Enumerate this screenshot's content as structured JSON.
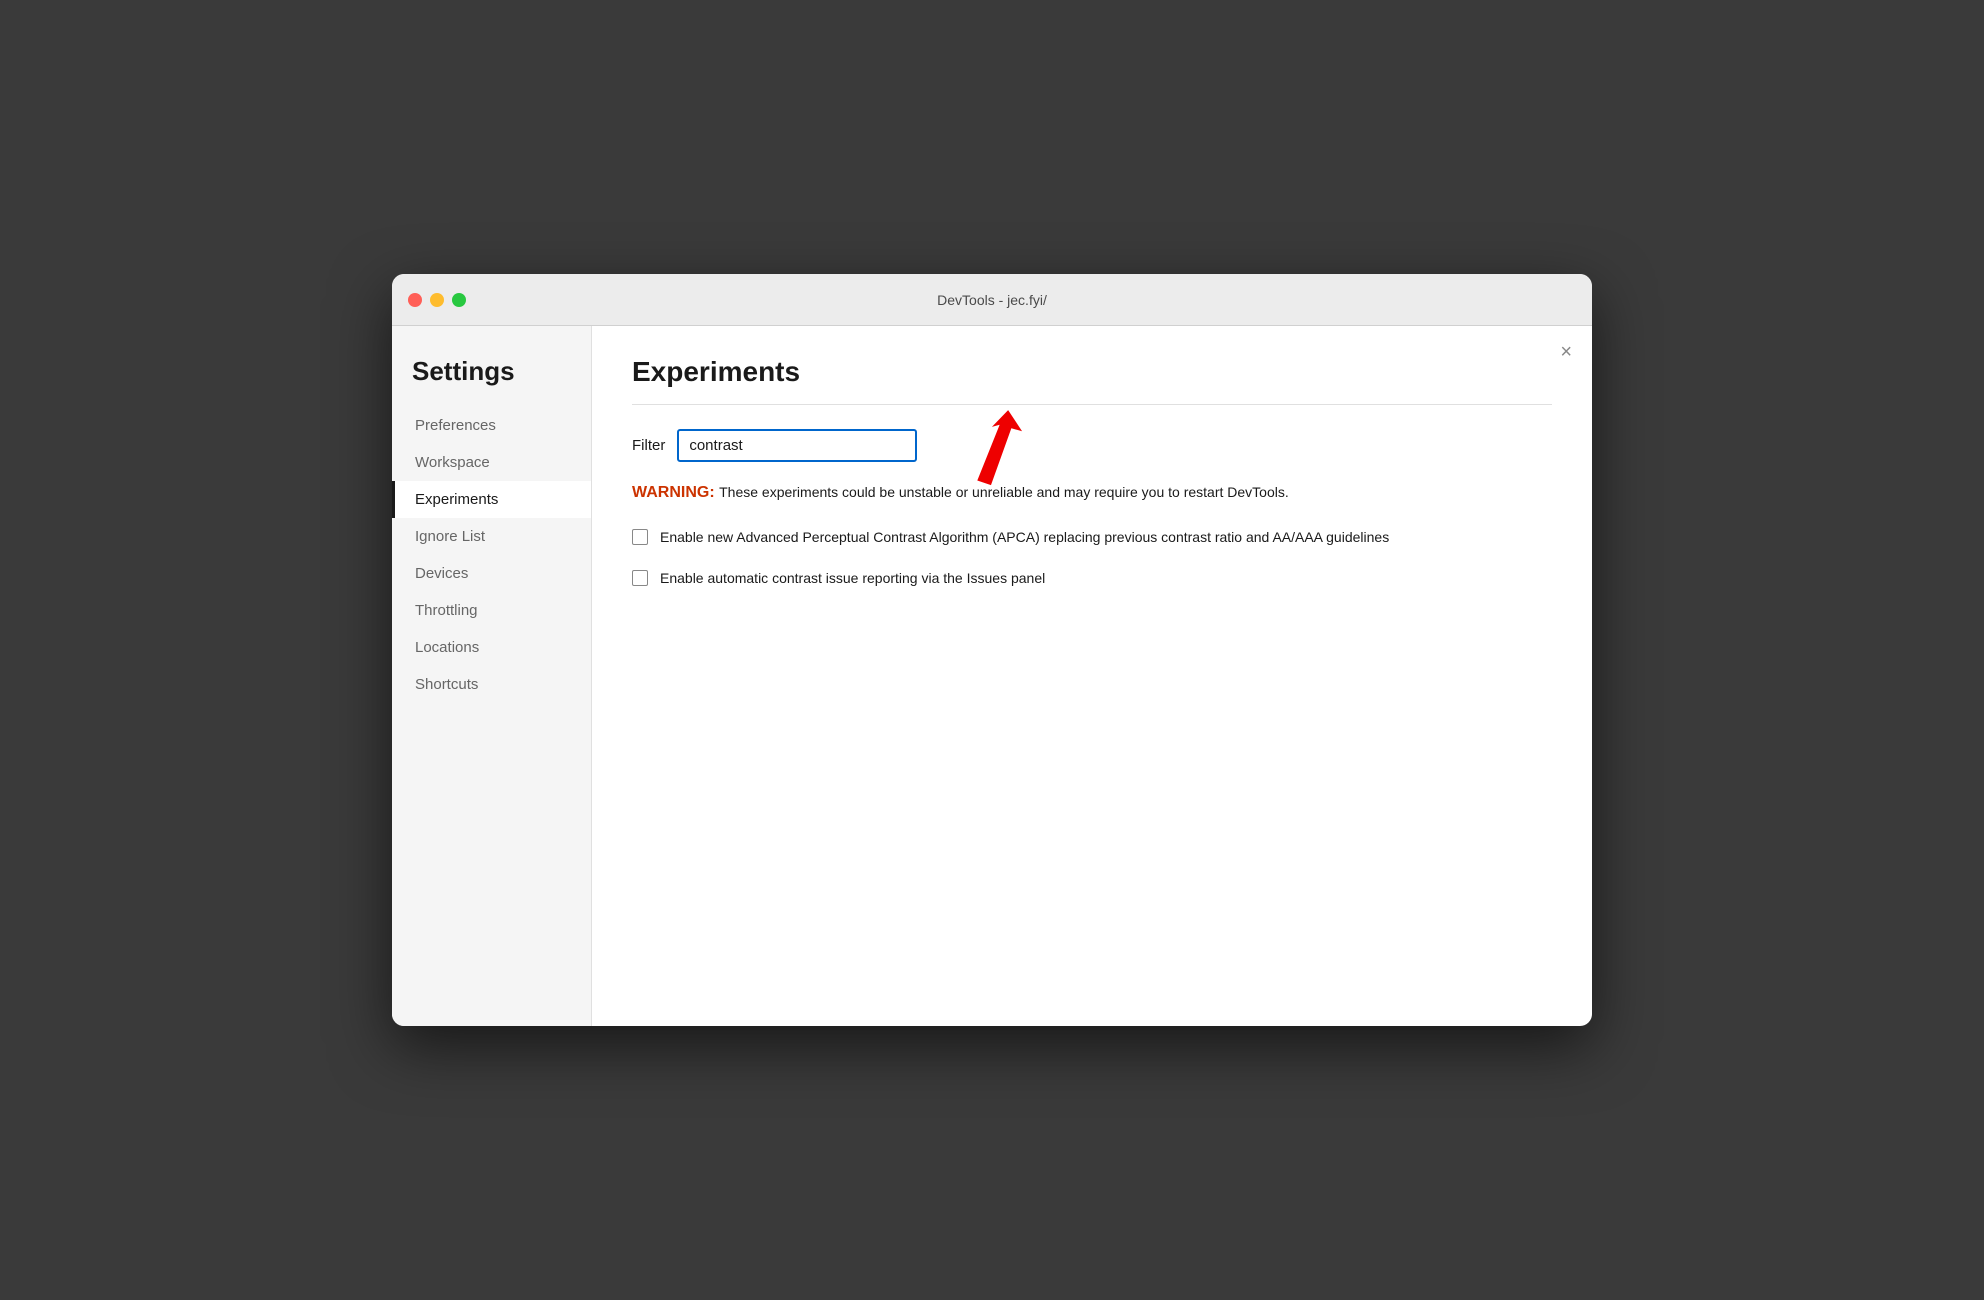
{
  "window": {
    "title": "DevTools - jec.fyi/"
  },
  "titlebar_buttons": {
    "close": "●",
    "minimize": "●",
    "maximize": "●"
  },
  "sidebar": {
    "heading": "Settings",
    "items": [
      {
        "id": "preferences",
        "label": "Preferences",
        "active": false
      },
      {
        "id": "workspace",
        "label": "Workspace",
        "active": false
      },
      {
        "id": "experiments",
        "label": "Experiments",
        "active": true
      },
      {
        "id": "ignore-list",
        "label": "Ignore List",
        "active": false
      },
      {
        "id": "devices",
        "label": "Devices",
        "active": false
      },
      {
        "id": "throttling",
        "label": "Throttling",
        "active": false
      },
      {
        "id": "locations",
        "label": "Locations",
        "active": false
      },
      {
        "id": "shortcuts",
        "label": "Shortcuts",
        "active": false
      }
    ]
  },
  "main": {
    "title": "Experiments",
    "filter_label": "Filter",
    "filter_value": "contrast",
    "close_label": "×",
    "warning_label": "WARNING:",
    "warning_text": " These experiments could be unstable or unreliable and may require you to restart DevTools.",
    "experiments": [
      {
        "id": "apca",
        "label": "Enable new Advanced Perceptual Contrast Algorithm (APCA) replacing previous contrast ratio and AA/AAA guidelines",
        "checked": false
      },
      {
        "id": "auto-contrast",
        "label": "Enable automatic contrast issue reporting via the Issues panel",
        "checked": false
      }
    ]
  },
  "colors": {
    "accent_blue": "#0066cc",
    "warning_red": "#cc3300",
    "active_sidebar_border": "#1a1a1a"
  }
}
